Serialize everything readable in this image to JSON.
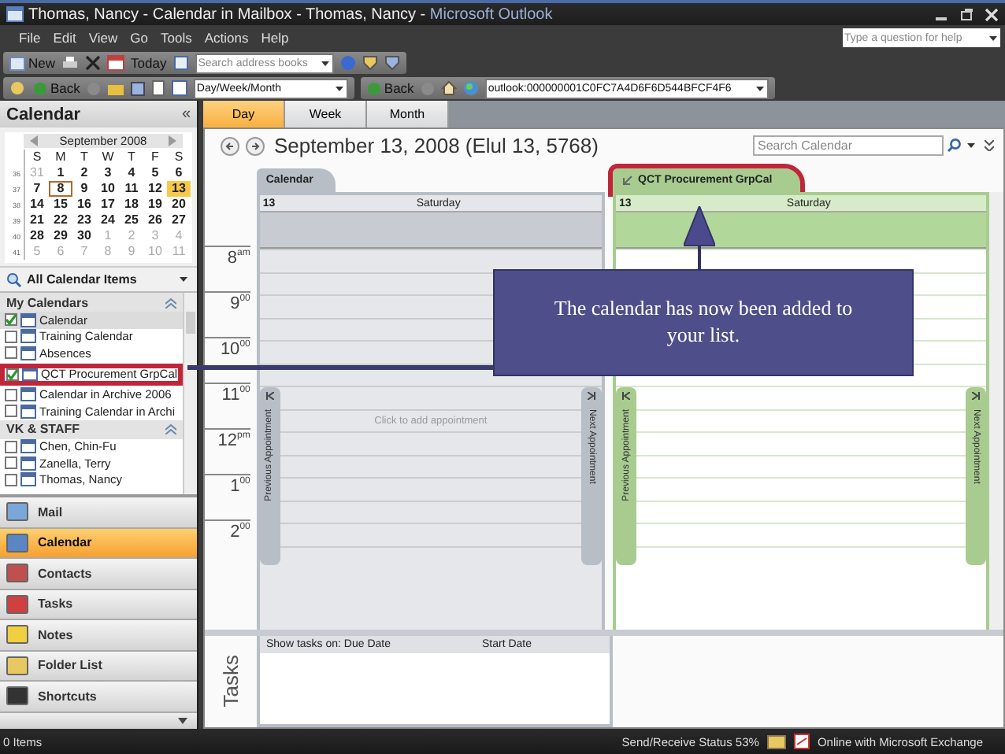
{
  "window": {
    "title": "Thomas, Nancy - Calendar in Mailbox - Thomas, Nancy - ",
    "app": "Microsoft Outlook"
  },
  "menu": [
    "File",
    "Edit",
    "View",
    "Go",
    "Tools",
    "Actions",
    "Help"
  ],
  "help_search": {
    "placeholder": "Type a question for help"
  },
  "toolbar_1": {
    "new": "New",
    "today": "Today",
    "address_search": {
      "placeholder": "Search address books"
    }
  },
  "toolbar_2": {
    "back": "Back",
    "view_select": {
      "value": "Day/Week/Month"
    }
  },
  "web_toolbar": {
    "back": "Back",
    "address": {
      "value": "outlook:000000001C0FC7A4D6F6D544BFCF4F6"
    }
  },
  "navigation_pane": {
    "title": "Calendar",
    "collapse": "«",
    "mini_calendar": {
      "month": "September 2008",
      "weekdays": [
        "S",
        "M",
        "T",
        "W",
        "T",
        "F",
        "S"
      ],
      "weeks": [
        {
          "number": "36",
          "days": [
            {
              "d": "31",
              "dim": true,
              "today": false,
              "selected": false
            },
            {
              "d": "1",
              "dim": false,
              "today": false,
              "selected": false
            },
            {
              "d": "2",
              "dim": false,
              "today": false,
              "selected": false
            },
            {
              "d": "3",
              "dim": false,
              "today": false,
              "selected": false
            },
            {
              "d": "4",
              "dim": false,
              "today": false,
              "selected": false
            },
            {
              "d": "5",
              "dim": false,
              "today": false,
              "selected": false
            },
            {
              "d": "6",
              "dim": false,
              "today": false,
              "selected": false
            }
          ]
        },
        {
          "number": "37",
          "days": [
            {
              "d": "7",
              "dim": false,
              "today": false,
              "selected": false
            },
            {
              "d": "8",
              "dim": false,
              "today": true,
              "selected": false
            },
            {
              "d": "9",
              "dim": false,
              "today": false,
              "selected": false
            },
            {
              "d": "10",
              "dim": false,
              "today": false,
              "selected": false
            },
            {
              "d": "11",
              "dim": false,
              "today": false,
              "selected": false
            },
            {
              "d": "12",
              "dim": false,
              "today": false,
              "selected": false
            },
            {
              "d": "13",
              "dim": false,
              "today": false,
              "selected": true
            }
          ]
        },
        {
          "number": "38",
          "days": [
            {
              "d": "14",
              "dim": false,
              "today": false,
              "selected": false
            },
            {
              "d": "15",
              "dim": false,
              "today": false,
              "selected": false
            },
            {
              "d": "16",
              "dim": false,
              "today": false,
              "selected": false
            },
            {
              "d": "17",
              "dim": false,
              "today": false,
              "selected": false
            },
            {
              "d": "18",
              "dim": false,
              "today": false,
              "selected": false
            },
            {
              "d": "19",
              "dim": false,
              "today": false,
              "selected": false
            },
            {
              "d": "20",
              "dim": false,
              "today": false,
              "selected": false
            }
          ]
        },
        {
          "number": "39",
          "days": [
            {
              "d": "21",
              "dim": false,
              "today": false,
              "selected": false
            },
            {
              "d": "22",
              "dim": false,
              "today": false,
              "selected": false
            },
            {
              "d": "23",
              "dim": false,
              "today": false,
              "selected": false
            },
            {
              "d": "24",
              "dim": false,
              "today": false,
              "selected": false
            },
            {
              "d": "25",
              "dim": false,
              "today": false,
              "selected": false
            },
            {
              "d": "26",
              "dim": false,
              "today": false,
              "selected": false
            },
            {
              "d": "27",
              "dim": false,
              "today": false,
              "selected": false
            }
          ]
        },
        {
          "number": "40",
          "days": [
            {
              "d": "28",
              "dim": false,
              "today": false,
              "selected": false
            },
            {
              "d": "29",
              "dim": false,
              "today": false,
              "selected": false
            },
            {
              "d": "30",
              "dim": false,
              "today": false,
              "selected": false
            },
            {
              "d": "1",
              "dim": true,
              "today": false,
              "selected": false
            },
            {
              "d": "2",
              "dim": true,
              "today": false,
              "selected": false
            },
            {
              "d": "3",
              "dim": true,
              "today": false,
              "selected": false
            },
            {
              "d": "4",
              "dim": true,
              "today": false,
              "selected": false
            }
          ]
        },
        {
          "number": "41",
          "days": [
            {
              "d": "5",
              "dim": true,
              "today": false,
              "selected": false
            },
            {
              "d": "6",
              "dim": true,
              "today": false,
              "selected": false
            },
            {
              "d": "7",
              "dim": true,
              "today": false,
              "selected": false
            },
            {
              "d": "8",
              "dim": true,
              "today": false,
              "selected": false
            },
            {
              "d": "9",
              "dim": true,
              "today": false,
              "selected": false
            },
            {
              "d": "10",
              "dim": true,
              "today": false,
              "selected": false
            },
            {
              "d": "11",
              "dim": true,
              "today": false,
              "selected": false
            }
          ]
        }
      ]
    },
    "view_filter": "All Calendar Items",
    "groups": [
      {
        "name": "My Calendars",
        "items": [
          {
            "label": "Calendar",
            "checked": true,
            "selected": true,
            "highlighted": false
          },
          {
            "label": "Training Calendar",
            "checked": false,
            "selected": false,
            "highlighted": false
          },
          {
            "label": "Absences",
            "checked": false,
            "selected": false,
            "highlighted": false
          },
          {
            "label": "QCT Procurement GrpCal",
            "checked": true,
            "selected": false,
            "highlighted": true
          },
          {
            "label": "Calendar in Archive 2006",
            "checked": false,
            "selected": false,
            "highlighted": false
          },
          {
            "label": "Training Calendar in Archi",
            "checked": false,
            "selected": false,
            "highlighted": false
          }
        ]
      },
      {
        "name": "VK & STAFF",
        "items": [
          {
            "label": "Chen, Chin-Fu",
            "checked": false,
            "selected": false,
            "highlighted": false
          },
          {
            "label": "Zanella, Terry",
            "checked": false,
            "selected": false,
            "highlighted": false
          },
          {
            "label": "Thomas, Nancy",
            "checked": false,
            "selected": false,
            "highlighted": false
          }
        ]
      }
    ],
    "buttons": [
      {
        "label": "Mail",
        "kind": "mail",
        "selected": false
      },
      {
        "label": "Calendar",
        "kind": "calendar",
        "selected": true
      },
      {
        "label": "Contacts",
        "kind": "contacts",
        "selected": false
      },
      {
        "label": "Tasks",
        "kind": "tasks",
        "selected": false
      },
      {
        "label": "Notes",
        "kind": "notes",
        "selected": false
      },
      {
        "label": "Folder List",
        "kind": "folder",
        "selected": false
      },
      {
        "label": "Shortcuts",
        "kind": "shortcut",
        "selected": false
      }
    ]
  },
  "view_tabs": [
    {
      "label": "Day",
      "selected": true
    },
    {
      "label": "Week",
      "selected": false
    },
    {
      "label": "Month",
      "selected": false
    }
  ],
  "date_heading": "September 13, 2008 (Elul 13, 5768)",
  "search": {
    "placeholder": "Search Calendar"
  },
  "calendars": [
    {
      "name": "Calendar",
      "kind": "own",
      "highlighted": false,
      "date": "13",
      "weekday": "Saturday",
      "hint": "Click to add appointment",
      "previous": "Previous Appointment",
      "next": "Next Appointment"
    },
    {
      "name": "QCT Procurement GrpCal",
      "kind": "shared",
      "highlighted": true,
      "date": "13",
      "weekday": "Saturday",
      "previous": "Previous Appointment",
      "next": "Next Appointment"
    }
  ],
  "time_slots": [
    {
      "hour": "8",
      "suffix": "am"
    },
    {
      "hour": "9",
      "suffix": "00"
    },
    {
      "hour": "10",
      "suffix": "00"
    },
    {
      "hour": "11",
      "suffix": "00"
    },
    {
      "hour": "12",
      "suffix": "pm"
    },
    {
      "hour": "1",
      "suffix": "00"
    },
    {
      "hour": "2",
      "suffix": "00"
    }
  ],
  "tasks": {
    "title": "Tasks",
    "column_1": "Show tasks on: Due Date",
    "column_2": "Start Date"
  },
  "status_bar": {
    "items": "0 Items",
    "send_receive": "Send/Receive Status 53%",
    "connection": "Online with Microsoft Exchange"
  },
  "callout": {
    "text": "The calendar has now been added to your list."
  }
}
